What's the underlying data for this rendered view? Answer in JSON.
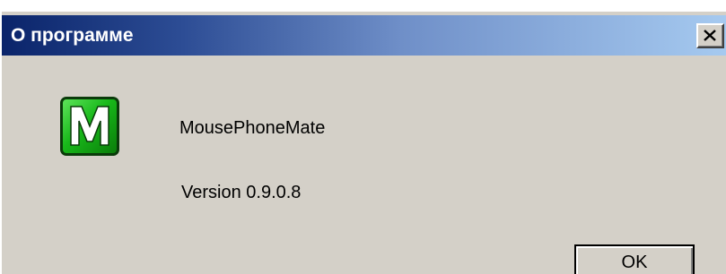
{
  "window": {
    "title": "О программе"
  },
  "app": {
    "name": "MousePhoneMate",
    "version": "Version 0.9.0.8",
    "icon": "green-m-icon"
  },
  "buttons": {
    "ok_label": "OK",
    "close_icon": "close-icon"
  },
  "colors": {
    "titlebar_start": "#0a246a",
    "titlebar_end": "#a6caf0",
    "dialog_background": "#d4d0c8",
    "icon_green": "#18b81a"
  }
}
